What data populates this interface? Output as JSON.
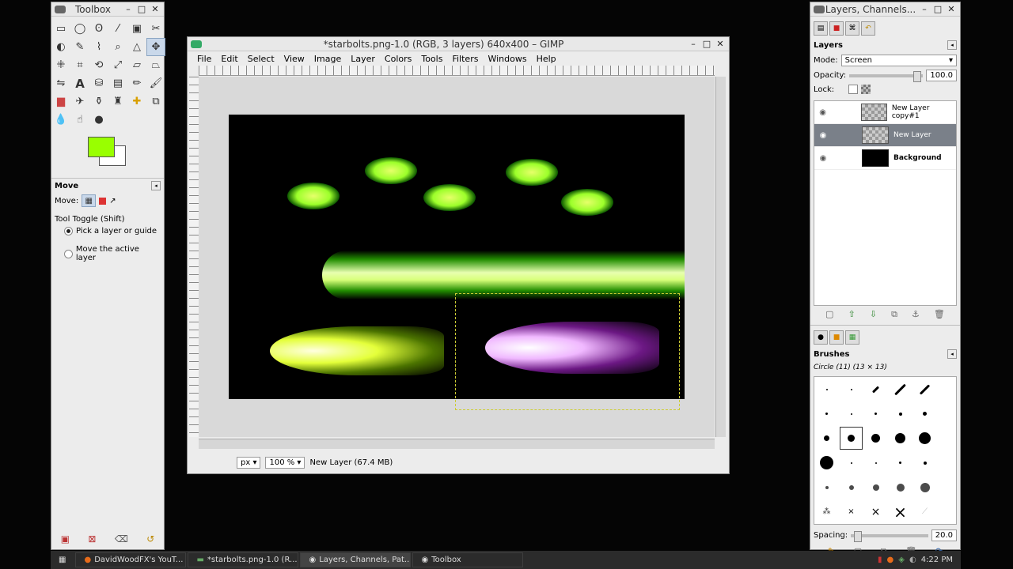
{
  "toolbox": {
    "title": "Toolbox",
    "section_title": "Move",
    "move_label": "Move:",
    "tool_toggle": "Tool Toggle  (Shift)",
    "option_1": "Pick a layer or guide",
    "option_2": "Move the active layer",
    "fg_color": "#99ff00",
    "bg_color": "#ffffff"
  },
  "image_window": {
    "title": "*starbolts.png-1.0 (RGB, 3 layers) 640x400 – GIMP",
    "menu": [
      "File",
      "Edit",
      "Select",
      "View",
      "Image",
      "Layer",
      "Colors",
      "Tools",
      "Filters",
      "Windows",
      "Help"
    ],
    "unit": "px",
    "zoom": "100 %",
    "status": "New Layer (67.4 MB)"
  },
  "layers_dock": {
    "title": "Layers, Channels...",
    "panel_title": "Layers",
    "mode_label": "Mode:",
    "mode_value": "Screen",
    "opacity_label": "Opacity:",
    "opacity_value": "100.0",
    "lock_label": "Lock:",
    "layers": [
      {
        "name": "New Layer copy#1",
        "selected": false
      },
      {
        "name": "New Layer",
        "selected": true
      },
      {
        "name": "Background",
        "selected": false
      }
    ],
    "brushes_title": "Brushes",
    "brush_name": "Circle (11) (13 × 13)",
    "spacing_label": "Spacing:",
    "spacing_value": "20.0"
  },
  "taskbar": {
    "items": [
      "DavidWoodFX's YouT...",
      "*starbolts.png-1.0 (R...",
      "Layers, Channels, Pat...",
      "Toolbox"
    ],
    "active_index": 2,
    "clock": "4:22 PM"
  }
}
